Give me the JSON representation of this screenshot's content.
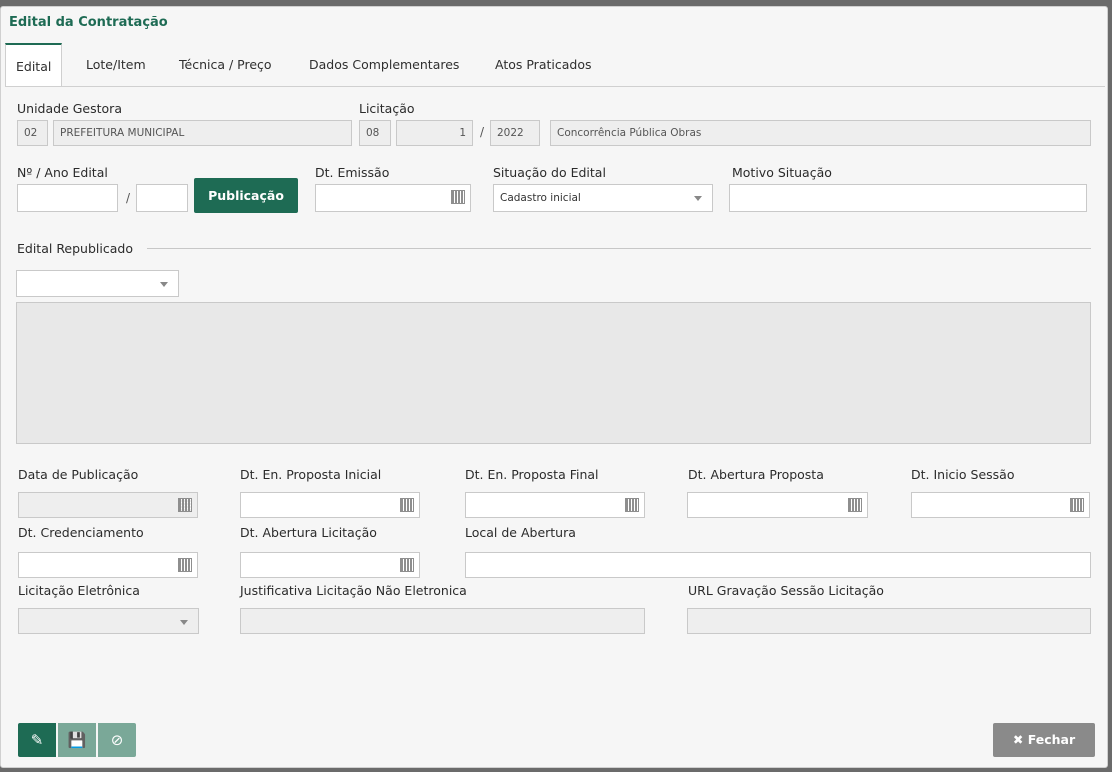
{
  "window": {
    "title": "Edital da Contratação"
  },
  "tabs": [
    {
      "label": "Edital"
    },
    {
      "label": "Lote/Item"
    },
    {
      "label": "Técnica / Preço"
    },
    {
      "label": "Dados Complementares"
    },
    {
      "label": "Atos Praticados"
    }
  ],
  "labels": {
    "unidade_gestora": "Unidade Gestora",
    "licitacao": "Licitação",
    "numero_ano_edital": "Nº / Ano Edital",
    "dt_emissao": "Dt. Emissão",
    "situacao_edital": "Situação do Edital",
    "motivo_situacao": "Motivo Situação",
    "edital_republicado": "Edital Republicado",
    "data_publicacao": "Data de Publicação",
    "dt_en_proposta_inicial": "Dt. En. Proposta Inicial",
    "dt_en_proposta_final": "Dt. En. Proposta Final",
    "dt_abertura_proposta": "Dt. Abertura Proposta",
    "dt_inicio_sessao": "Dt. Inicio Sessão",
    "dt_credenciamento": "Dt. Credenciamento",
    "dt_abertura_licitacao": "Dt. Abertura Licitação",
    "local_abertura": "Local de Abertura",
    "licitacao_eletronica": "Licitação Eletrônica",
    "justificativa": "Justificativa Licitação Não Eletronica",
    "url_gravacao": "URL Gravação Sessão Licitação"
  },
  "values": {
    "ug_code": "02",
    "ug_name": "PREFEITURA MUNICIPAL",
    "lic_mod": "08",
    "lic_num": "1",
    "lic_ano": "2022",
    "lic_desc": "Concorrência Pública Obras",
    "situacao": "Cadastro inicial",
    "slash": "/"
  },
  "buttons": {
    "publicacao": "Publicação",
    "fechar": "Fechar"
  },
  "colors": {
    "accent": "#1e6b54",
    "button_gray": "#8a8a8a"
  }
}
